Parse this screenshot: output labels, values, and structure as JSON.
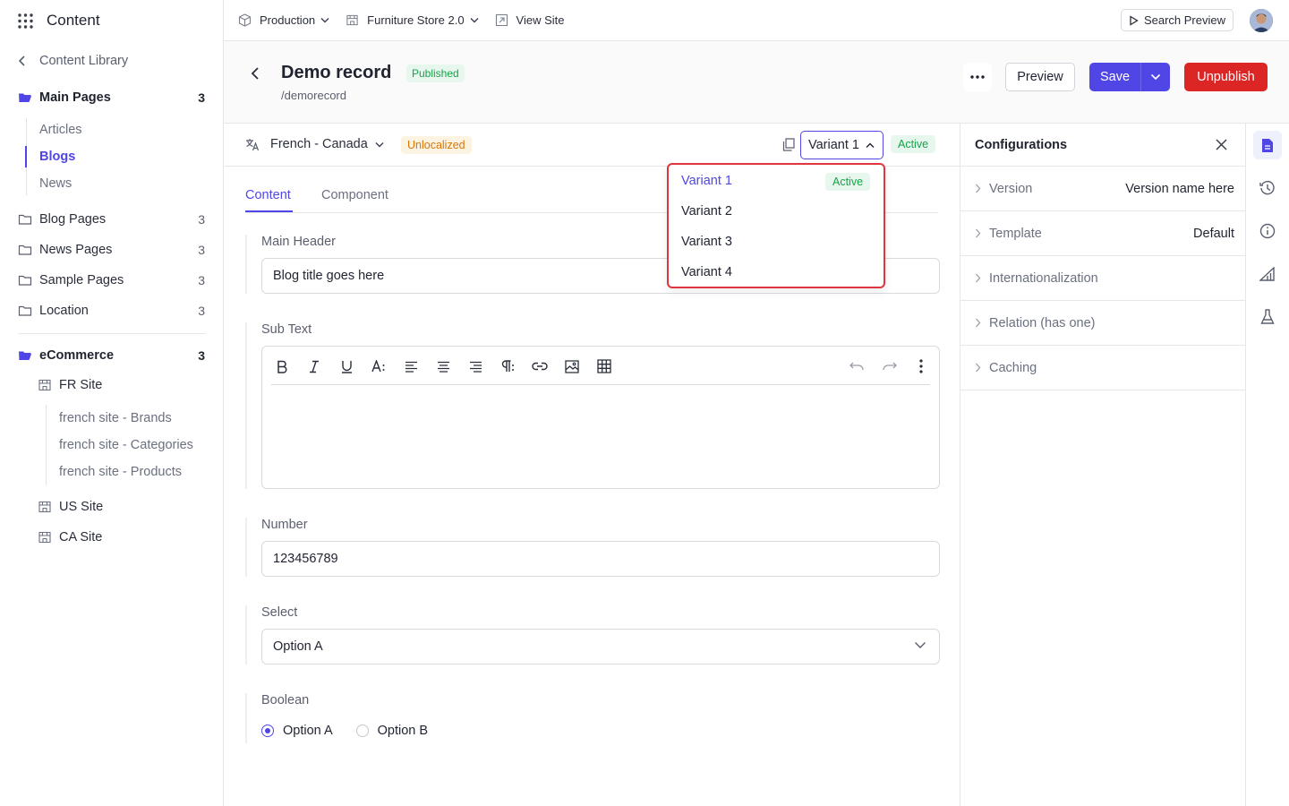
{
  "app": {
    "title": "Content"
  },
  "sidebar": {
    "back_label": "Content Library",
    "main_pages": {
      "label": "Main Pages",
      "count": "3"
    },
    "main_sub": [
      "Articles",
      "Blogs",
      "News"
    ],
    "folders": [
      {
        "label": "Blog Pages",
        "count": "3"
      },
      {
        "label": "News Pages",
        "count": "3"
      },
      {
        "label": "Sample Pages",
        "count": "3"
      },
      {
        "label": "Location",
        "count": "3"
      }
    ],
    "ecommerce": {
      "label": "eCommerce",
      "count": "3"
    },
    "fr_site": "FR Site",
    "fr_children": [
      "french site - Brands",
      "french site - Categories",
      "french site - Products"
    ],
    "us_site": "US Site",
    "ca_site": "CA Site"
  },
  "topbar": {
    "environment": "Production",
    "project": "Furniture Store 2.0",
    "view_site": "View Site",
    "search_preview": "Search Preview"
  },
  "record": {
    "title": "Demo record",
    "status": "Published",
    "path": "/demorecord",
    "preview_label": "Preview",
    "save_label": "Save",
    "unpublish_label": "Unpublish"
  },
  "locale": {
    "label": "French - Canada",
    "status": "Unlocalized",
    "variant": "Variant 1",
    "variant_status": "Active"
  },
  "dropdown": {
    "items": [
      "Variant 1",
      "Variant 2",
      "Variant 3",
      "Variant 4"
    ],
    "active_badge": "Active"
  },
  "tabs": [
    "Content",
    "Component"
  ],
  "fields": {
    "main_header": {
      "label": "Main Header",
      "value": "Blog title goes here"
    },
    "sub_text": {
      "label": "Sub Text"
    },
    "number": {
      "label": "Number",
      "value": "123456789"
    },
    "select": {
      "label": "Select",
      "value": "Option A"
    },
    "boolean": {
      "label": "Boolean",
      "options": [
        "Option A",
        "Option B"
      ],
      "selected": "Option A"
    }
  },
  "config": {
    "title": "Configurations",
    "rows": [
      {
        "key": "Version",
        "value": "Version name here"
      },
      {
        "key": "Template",
        "value": "Default"
      },
      {
        "key": "Internationalization",
        "value": ""
      },
      {
        "key": "Relation (has one)",
        "value": ""
      },
      {
        "key": "Caching",
        "value": ""
      }
    ]
  },
  "colors": {
    "accent": "#4f46e5",
    "danger": "#dc2626",
    "success": "#16a34a",
    "warning": "#d97706"
  }
}
